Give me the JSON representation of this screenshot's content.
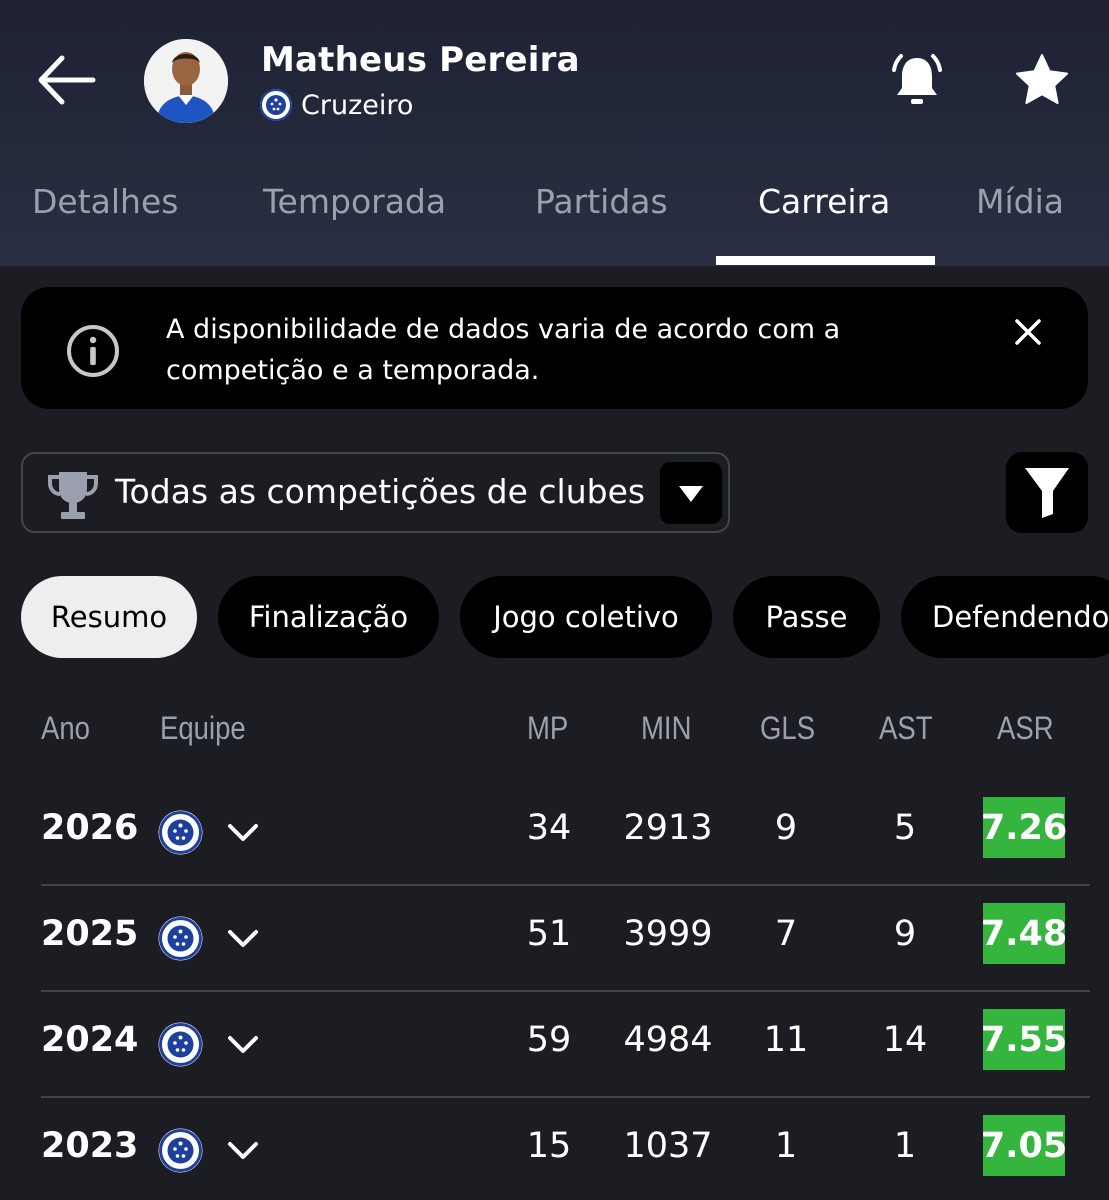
{
  "player": {
    "name": "Matheus Pereira",
    "team": "Cruzeiro"
  },
  "tabs": [
    {
      "label": "Detalhes"
    },
    {
      "label": "Temporada"
    },
    {
      "label": "Partidas"
    },
    {
      "label": "Carreira",
      "active": true
    },
    {
      "label": "Mídia"
    }
  ],
  "info_banner": {
    "line1": "A disponibilidade de dados varia de acordo com a",
    "line2": "competição e a temporada."
  },
  "competition_select": {
    "value": "Todas as competições de clubes"
  },
  "chips": [
    {
      "label": "Resumo",
      "active": true
    },
    {
      "label": "Finalização"
    },
    {
      "label": "Jogo coletivo"
    },
    {
      "label": "Passe"
    },
    {
      "label": "Defendendo"
    }
  ],
  "table": {
    "headers": {
      "year": "Ano",
      "team": "Equipe",
      "mp": "MP",
      "min": "MIN",
      "gls": "GLS",
      "ast": "AST",
      "asr": "ASR"
    },
    "rows": [
      {
        "year": "2026",
        "mp": "34",
        "min": "2913",
        "gls": "9",
        "ast": "5",
        "asr": "7.26"
      },
      {
        "year": "2025",
        "mp": "51",
        "min": "3999",
        "gls": "7",
        "ast": "9",
        "asr": "7.48"
      },
      {
        "year": "2024",
        "mp": "59",
        "min": "4984",
        "gls": "11",
        "ast": "14",
        "asr": "7.55"
      },
      {
        "year": "2023",
        "mp": "15",
        "min": "1037",
        "gls": "1",
        "ast": "1",
        "asr": "7.05"
      }
    ]
  },
  "colors": {
    "rating_green": "#35b53e",
    "header_bg": "#1d2133",
    "page_bg": "#1b1d22",
    "crest_blue": "#1d3f9e"
  },
  "icons": [
    "arrow-left-icon",
    "bell-icon",
    "star-icon",
    "info-icon",
    "close-icon",
    "trophy-icon",
    "caret-down-icon",
    "filter-icon",
    "club-crest-icon",
    "chevron-down-icon"
  ]
}
